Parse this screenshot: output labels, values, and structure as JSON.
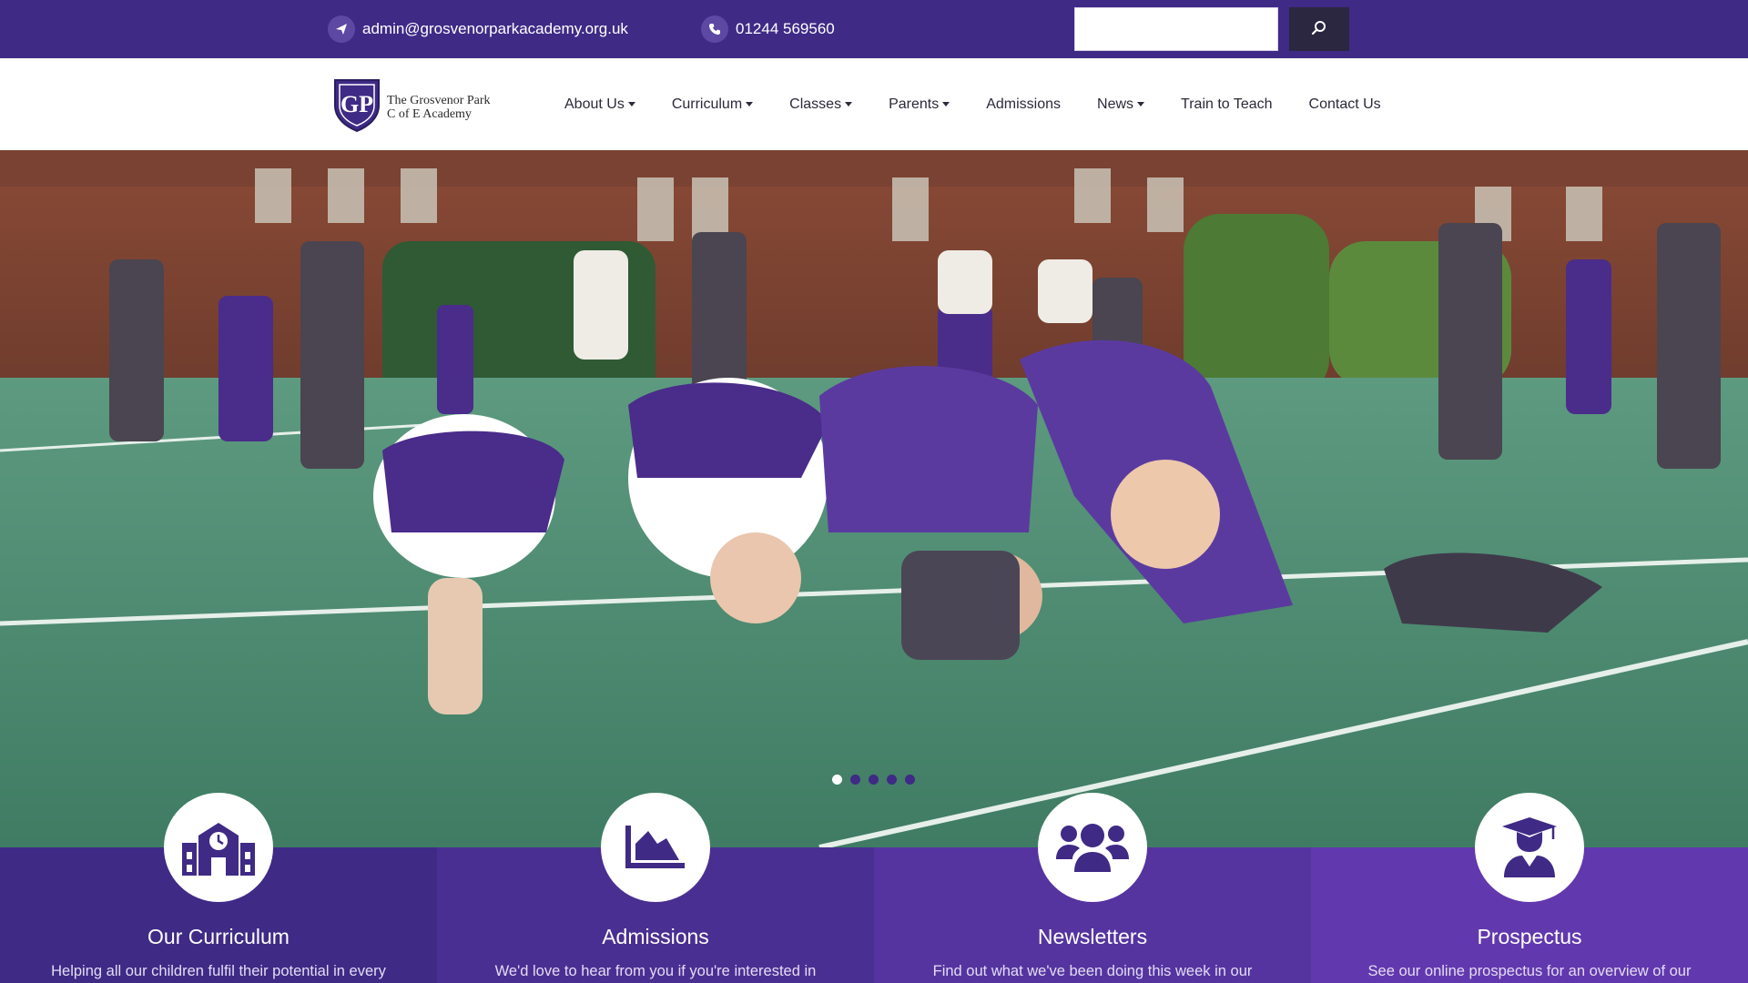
{
  "topbar": {
    "email": "admin@grosvenorparkacademy.org.uk",
    "phone": "01244 569560",
    "search": {
      "placeholder": "",
      "value": ""
    }
  },
  "logo": {
    "monogram": "GP",
    "line1": "The Grosvenor Park",
    "line2": "C of E Academy"
  },
  "nav": [
    {
      "label": "About Us"
    },
    {
      "label": "Curriculum"
    },
    {
      "label": "Classes"
    },
    {
      "label": "Parents"
    },
    {
      "label": "Admissions"
    },
    {
      "label": "News"
    },
    {
      "label": "Train to Teach"
    },
    {
      "label": "Contact Us"
    }
  ],
  "hero": {
    "slide_count": 5,
    "active_slide": 1
  },
  "features": [
    {
      "title": "Our Curriculum",
      "desc": "Helping all our children fulfil their potential in every",
      "icon": "school-icon",
      "bg": "#3f2a86"
    },
    {
      "title": "Admissions",
      "desc": "We'd love to hear from you if you're interested in",
      "icon": "chart-area-icon",
      "bg": "#4a2f92"
    },
    {
      "title": "Newsletters",
      "desc": "Find out what we've been doing this week in our",
      "icon": "users-icon",
      "bg": "#5534a0"
    },
    {
      "title": "Prospectus",
      "desc": "See our online prospectus for an overview of our",
      "icon": "graduate-icon",
      "bg": "#6238ae"
    }
  ],
  "colors": {
    "primary": "#3f2a86",
    "dark": "#2b2740",
    "white": "#ffffff"
  }
}
